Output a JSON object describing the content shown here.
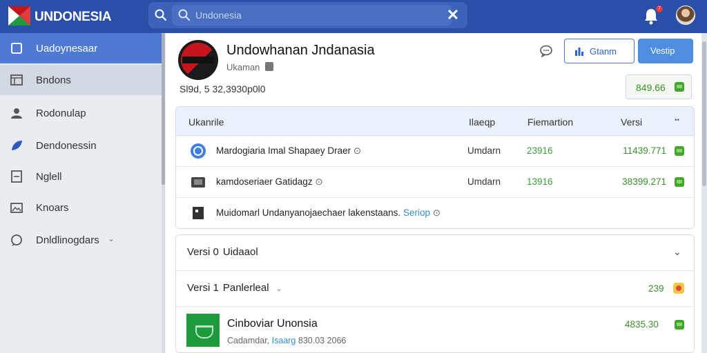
{
  "header": {
    "logo_text": "UNDONESIA",
    "search_placeholder": "Undonesia",
    "notification_count": "7"
  },
  "sidebar": {
    "items": [
      {
        "label": "Uadoynesaar",
        "icon": "box-icon"
      },
      {
        "label": "Bndons",
        "icon": "table-icon"
      },
      {
        "label": "Rodonulap",
        "icon": "user-icon"
      },
      {
        "label": "Dendonessin",
        "icon": "leaf-icon"
      },
      {
        "label": "Nglell",
        "icon": "document-icon"
      },
      {
        "label": "Knoars",
        "icon": "image-icon"
      },
      {
        "label": "Dnldlinogdars",
        "icon": "chat-icon"
      }
    ]
  },
  "main": {
    "title": "Undowhanan Jndanasia",
    "subtitle": "Ukaman",
    "meta": "Sl9d, 5 32,3930p0l0",
    "buttons": {
      "outline_label": "Gtanm",
      "solid_label": "Vestip"
    },
    "total": "849.66"
  },
  "table": {
    "headers": {
      "name": "Ukanrile",
      "status": "Ilaeqp",
      "qty": "Fiemartion",
      "amount": "Versi"
    },
    "rows": [
      {
        "name": "Mardogiaria  Imal  Shapaey  Draer",
        "status": "Umdarn",
        "qty": "23916",
        "amount": "11439.771"
      },
      {
        "name": "kamdoseriaer  Gatidagz",
        "status": "Umdarn",
        "qty": "13916",
        "amount": "38399.271"
      },
      {
        "name": "Muidomarl Undanyanojaechaer lakenstaans.",
        "link": "Seriop"
      }
    ]
  },
  "versions": [
    {
      "label": "Versi  0",
      "name": "Uidaaol"
    },
    {
      "label": "Versi 1",
      "name": "Panlerleal",
      "amount": "239"
    }
  ],
  "product": {
    "name": "Cinboviar Unonsia",
    "meta_prefix": "Cadamdar,",
    "meta_link": "Isaarg",
    "meta_suffix": "830.03 2066",
    "amount": "4835.30"
  }
}
